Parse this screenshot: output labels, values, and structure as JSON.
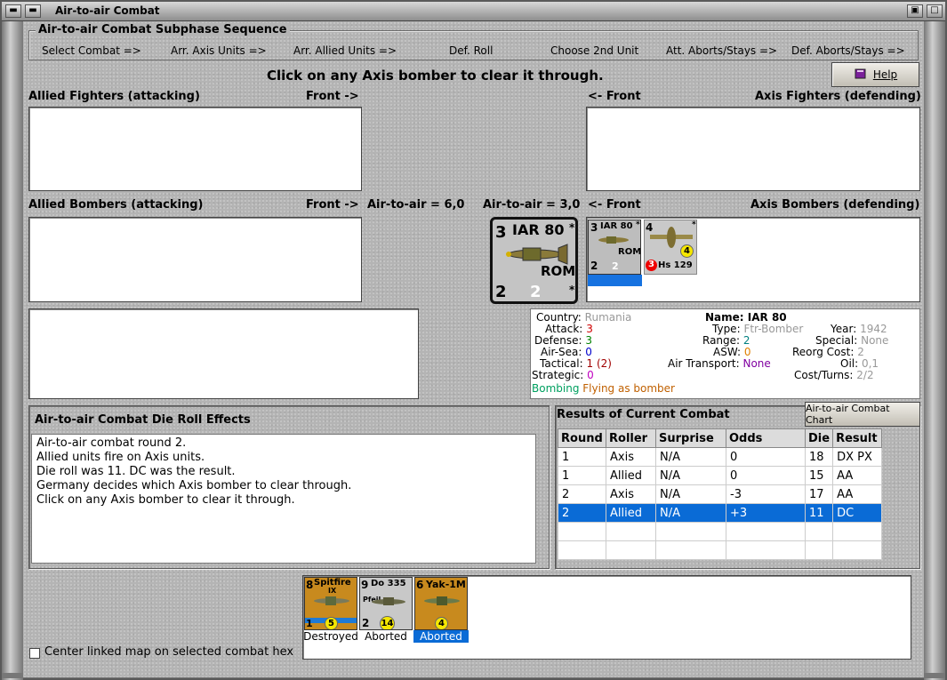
{
  "window": {
    "title": "Air-to-air Combat"
  },
  "sequence": {
    "legend": "Air-to-air Combat Subphase Sequence",
    "steps": [
      "Select Combat =>",
      "Arr. Axis Units =>",
      "Arr. Allied Units =>",
      "Def. Roll",
      "Choose 2nd Unit",
      "Att. Aborts/Stays =>",
      "Def. Aborts/Stays =>"
    ]
  },
  "instruction": "Click on any Axis bomber to clear it through.",
  "help_label": "Help",
  "sections": {
    "allied_fighters": "Allied Fighters (attacking)",
    "allied_fighters_front": "Front ->",
    "axis_fighters_front": "<- Front",
    "axis_fighters": "Axis Fighters (defending)",
    "allied_bombers": "Allied Bombers (attacking)",
    "allied_bombers_front": "Front ->",
    "allied_air_to_air": "Air-to-air = 6,0",
    "axis_air_to_air": "Air-to-air = 3,0",
    "axis_bombers_front": "<- Front",
    "axis_bombers": "Axis Bombers (defending)"
  },
  "selected_unit_counter": {
    "name": "IAR 80",
    "nation": "ROM",
    "top_left": "3",
    "bottom_left": "2",
    "bottom_mid": "2",
    "star": "*"
  },
  "axis_bombers": [
    {
      "name": "IAR 80",
      "nation": "ROM",
      "top_left": "3",
      "bottom_left": "2",
      "bottom_mid": "2",
      "star": "*"
    },
    {
      "name": "Hs 129",
      "top_left": "4",
      "badge": "4",
      "red_badge": "3",
      "star": "*"
    }
  ],
  "unit_info": {
    "country_label": "Country:",
    "country": "Rumania",
    "attack_label": "Attack:",
    "attack": "3",
    "defense_label": "Defense:",
    "defense": "3",
    "airsea_label": "Air-Sea:",
    "airsea": "0",
    "tactical_label": "Tactical:",
    "tactical": "1 (2)",
    "strategic_label": "Strategic:",
    "strategic": "0",
    "bombing_label": "Bombing",
    "bombing": "Flying as bomber",
    "name_label": "Name:",
    "name": "IAR 80",
    "type_label": "Type:",
    "type": "Ftr-Bomber",
    "range_label": "Range:",
    "range": "2",
    "asw_label": "ASW:",
    "asw": "0",
    "airtransport_label": "Air Transport:",
    "airtransport": "None",
    "year_label": "Year:",
    "year": "1942",
    "special_label": "Special:",
    "special": "None",
    "reorg_label": "Reorg Cost:",
    "reorg": "2",
    "oil_label": "Oil:",
    "oil": "0,1",
    "costturns_label": "Cost/Turns:",
    "costturns": "2/2",
    "colors": {
      "attack": "#d00000",
      "defense": "#008000",
      "airsea": "#0000cc",
      "tactical": "#a00000",
      "strategic": "#c000c0",
      "bombing": "#00a060",
      "bombing_value": "#c06000",
      "range": "#008080",
      "asw": "#e08000",
      "airtransport": "#8000a0"
    }
  },
  "die_roll": {
    "title": "Air-to-air Combat Die Roll Effects",
    "lines": [
      "Air-to-air combat round 2.",
      "Allied units fire on Axis units.",
      "Die roll was 11.  DC was the result.",
      "Germany decides which Axis bomber to clear through.",
      "Click on any Axis bomber to clear it through."
    ]
  },
  "results": {
    "title": "Results of Current Combat",
    "chart_button": "Air-to-air Combat Chart",
    "headers": [
      "Round",
      "Roller",
      "Surprise",
      "Odds",
      "Die",
      "Result"
    ],
    "rows": [
      [
        "1",
        "Axis",
        "N/A",
        "0",
        "18",
        "DX PX"
      ],
      [
        "1",
        "Allied",
        "N/A",
        "0",
        "15",
        "AA"
      ],
      [
        "2",
        "Axis",
        "N/A",
        "-3",
        "17",
        "AA"
      ],
      [
        "2",
        "Allied",
        "N/A",
        "+3",
        "11",
        "DC"
      ]
    ],
    "selected_row": 3
  },
  "bottom_units": [
    {
      "name": "Spitfire",
      "sub": "IX",
      "top_left": "8",
      "bottom_left": "1",
      "badge": "5",
      "result": "Destroyed"
    },
    {
      "name": "Do 335",
      "sub": "Pfeil",
      "top_left": "9",
      "bottom_left": "2",
      "badge": "14",
      "result": "Aborted"
    },
    {
      "name": "Yak-1M",
      "top_left": "6",
      "badge": "4",
      "result": "Aborted"
    }
  ],
  "center_map_label": "Center linked map on selected combat hex"
}
